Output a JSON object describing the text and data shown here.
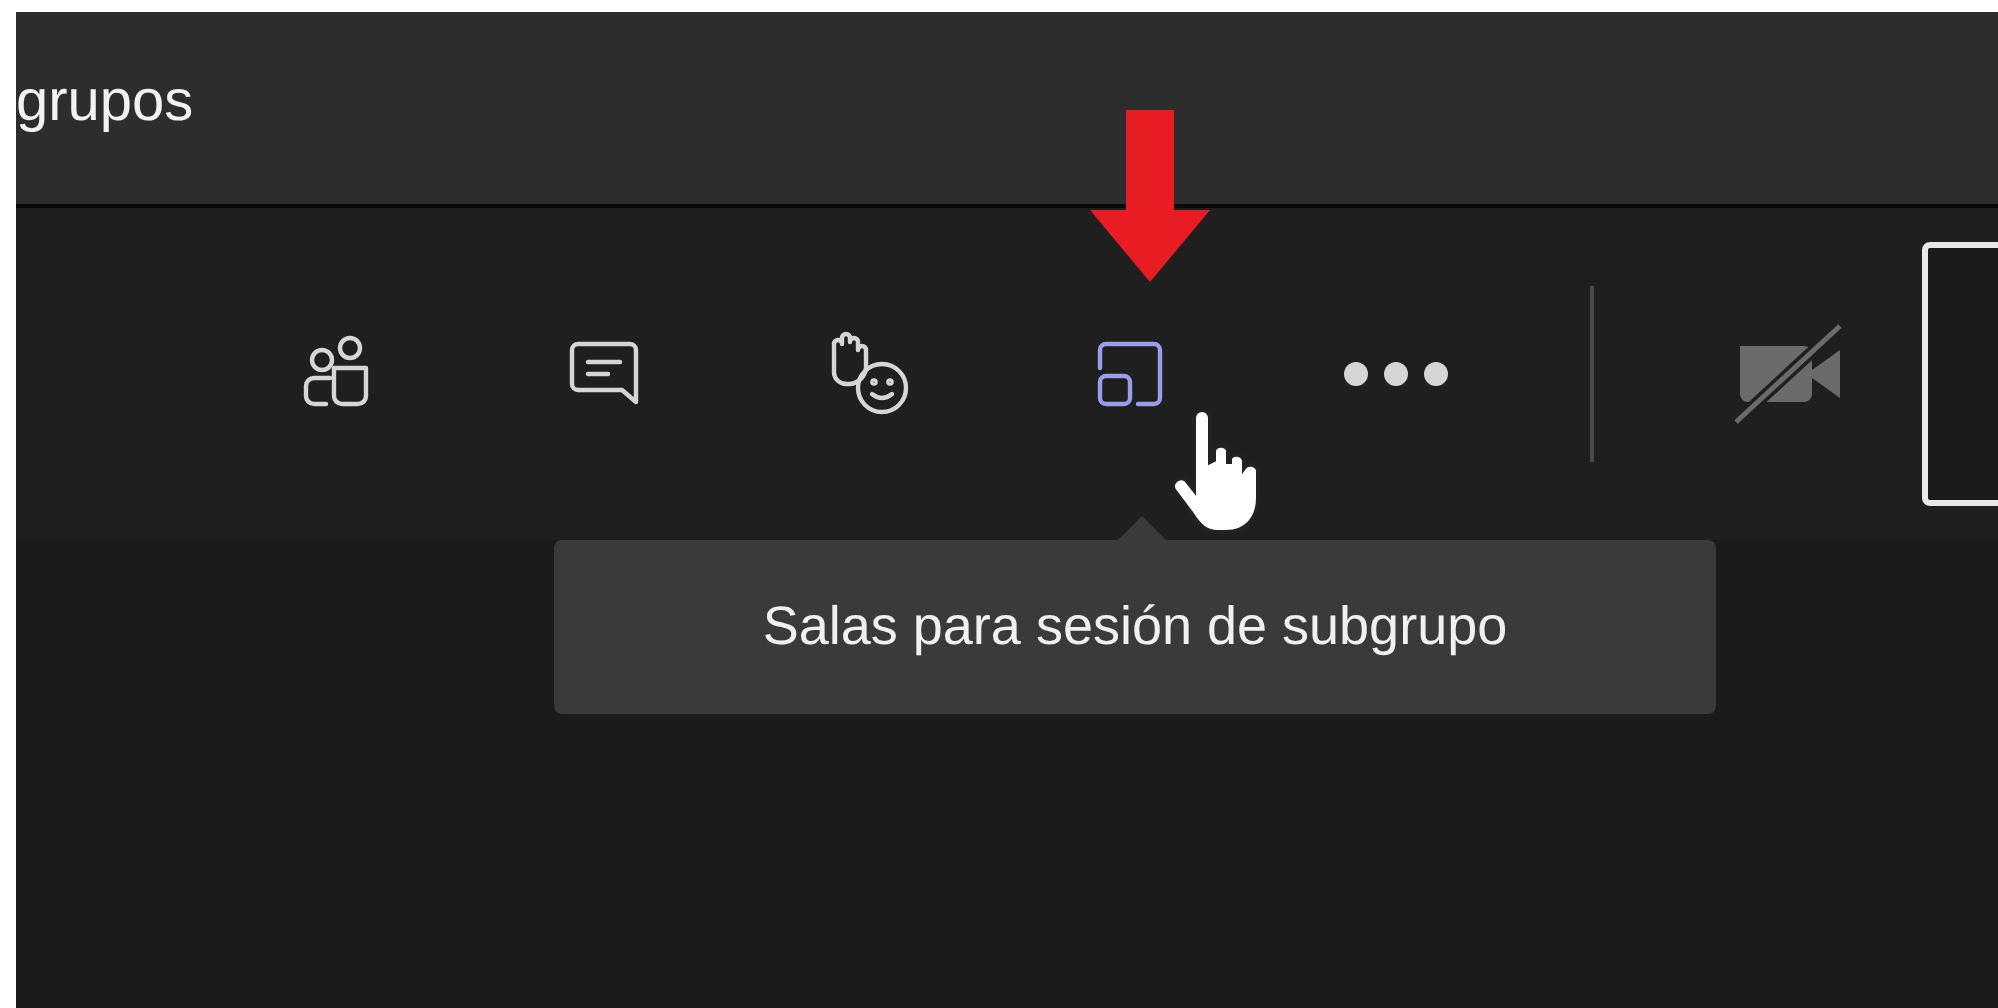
{
  "window": {
    "title": "grupos"
  },
  "toolbar": {
    "buttons": [
      {
        "kind": "people",
        "selected": false
      },
      {
        "kind": "chat",
        "selected": false
      },
      {
        "kind": "reactions",
        "selected": false
      },
      {
        "kind": "rooms",
        "selected": true
      },
      {
        "kind": "more",
        "selected": false
      },
      {
        "kind": "camera",
        "selected": false,
        "disabled": true
      }
    ]
  },
  "tooltip": {
    "text": "Salas para sesión de subgrupo"
  }
}
